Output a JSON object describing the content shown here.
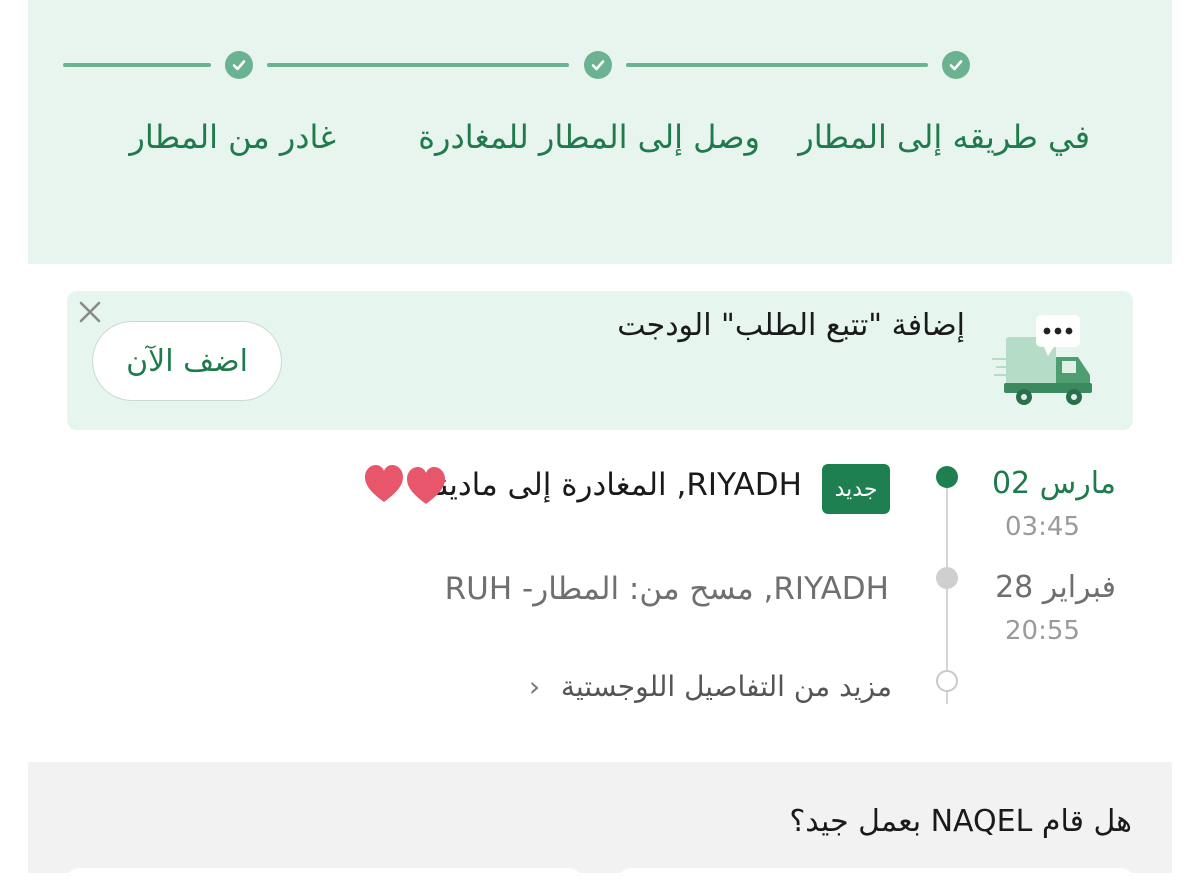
{
  "progress": {
    "steps": [
      {
        "label": "في طريقه إلى المطار",
        "state": "done"
      },
      {
        "label": "وصل إلى المطار للمغادرة",
        "state": "done"
      },
      {
        "label": "غادر من المطار",
        "state": "done"
      }
    ]
  },
  "widget_promo": {
    "title": "إضافة \"تتبع الطلب\" الودجت",
    "button_label": "اضف الآن",
    "close_icon": "close-icon",
    "illustration": "delivery-truck-icon"
  },
  "timeline": {
    "events": [
      {
        "date": "مارس 02",
        "time": "03:45",
        "badge": "جديد",
        "text": "RIYADH, المغادرة إلى مادينا",
        "status": "current"
      },
      {
        "date": "فبراير 28",
        "time": "20:55",
        "text": "RIYADH, مسح من: المطار- RUH",
        "status": "past"
      }
    ],
    "more_link": "مزيد من التفاصيل اللوجستية",
    "more_icon": "chevron-left-icon"
  },
  "rating": {
    "question": "هل قام NAQEL بعمل جيد؟"
  },
  "colors": {
    "brand_green": "#1f7a4c",
    "step_green": "#6bb292",
    "panel_bg": "#e8f4ee",
    "badge_bg": "#1e8050",
    "heart": "#e8566c"
  }
}
